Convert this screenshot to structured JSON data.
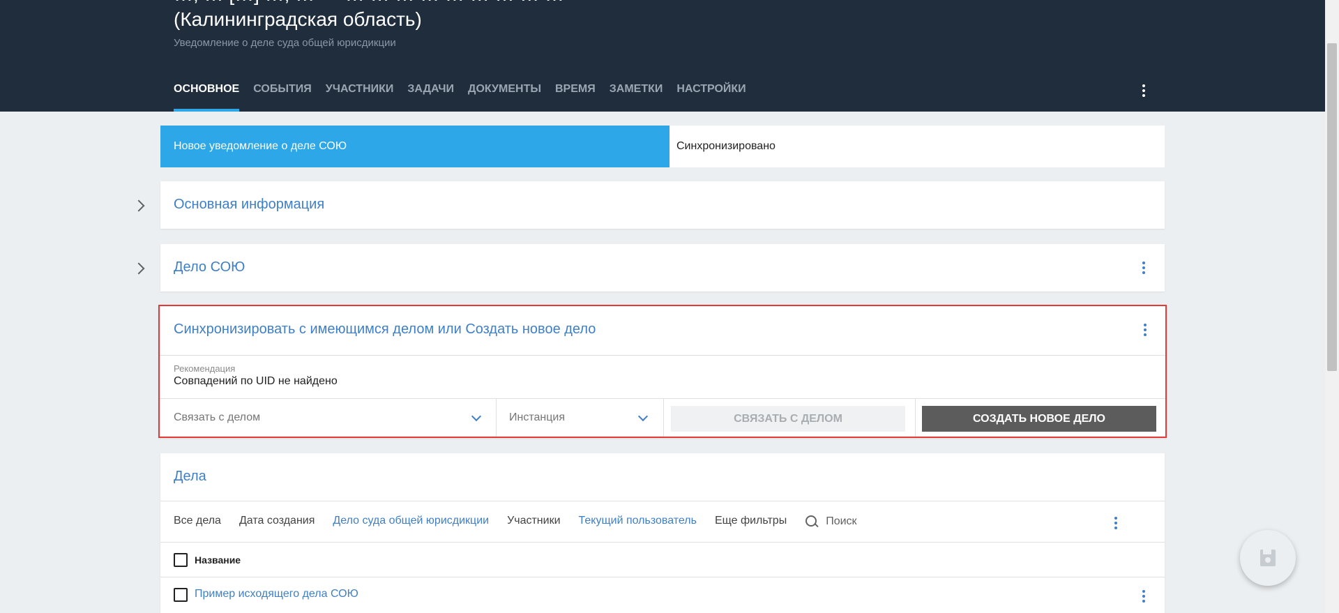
{
  "header": {
    "title_top_partial": "…, … […] …, … — … … … … … … … … …",
    "title": "(Калининградская область)",
    "subtitle": "Уведомление о деле суда общей юрисдикции",
    "tabs": [
      {
        "label": "ОСНОВНОЕ",
        "active": true
      },
      {
        "label": "СОБЫТИЯ"
      },
      {
        "label": "УЧАСТНИКИ"
      },
      {
        "label": "ЗАДАЧИ"
      },
      {
        "label": "ДОКУМЕНТЫ"
      },
      {
        "label": "ВРЕМЯ"
      },
      {
        "label": "ЗАМЕТКИ"
      },
      {
        "label": "НАСТРОЙКИ"
      }
    ],
    "menu_icon": "more-vertical-icon"
  },
  "status_bar": {
    "current": "Новое уведомление о деле СОЮ",
    "next": "Синхронизировано"
  },
  "sections": {
    "main_info": {
      "title": "Основная информация"
    },
    "case_sou": {
      "title": "Дело СОЮ"
    }
  },
  "sync": {
    "title": "Синхронизировать с имеющимся делом или Создать новое дело",
    "recommendation_label": "Рекомендация",
    "recommendation_value": "Совпадений по UID не найдено",
    "link_case_placeholder": "Связать с делом",
    "instance_placeholder": "Инстанция",
    "link_button": "СВЯЗАТЬ С ДЕЛОМ",
    "create_button": "СОЗДАТЬ НОВОЕ ДЕЛО"
  },
  "cases": {
    "title": "Дела",
    "filters": [
      {
        "label": "Все дела",
        "link": false
      },
      {
        "label": "Дата создания",
        "link": false
      },
      {
        "label": "Дело суда общей юрисдикции",
        "link": true
      },
      {
        "label": "Участники",
        "link": false
      },
      {
        "label": "Текущий пользователь",
        "link": true
      },
      {
        "label": "Еще фильтры",
        "link": false
      }
    ],
    "search_label": "Поиск",
    "column_name": "Название",
    "rows": [
      {
        "name": "Пример исходящего дела СОЮ"
      }
    ]
  },
  "colors": {
    "header_bg": "#1f2d3d",
    "accent": "#2ea7e8",
    "link": "#3f7fc6",
    "highlight_border": "#e53935",
    "dark_button": "#5c5c5c"
  }
}
